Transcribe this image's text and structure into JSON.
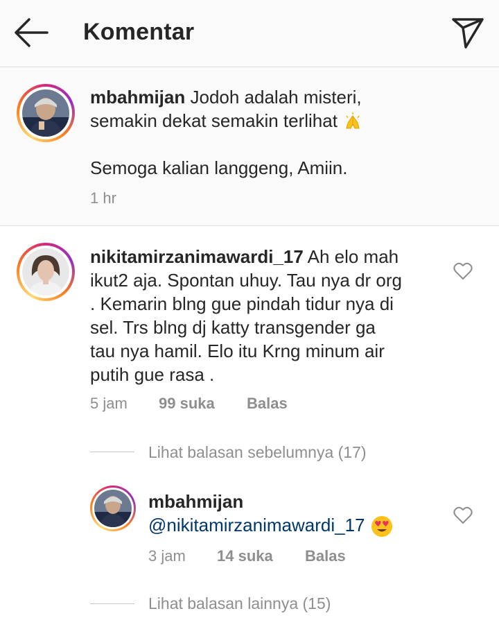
{
  "header": {
    "title": "Komentar",
    "back_icon": "arrow-left-icon",
    "share_icon": "paper-plane-icon"
  },
  "caption": {
    "username": "mbahmijan",
    "line1": "Jodoh adalah misteri,",
    "line2": "semakin dekat semakin terlihat",
    "line3": "Semoga kalian langgeng, Amiin.",
    "time": "1 hr",
    "emoji": "folded-hands-emoji"
  },
  "comments": [
    {
      "username": "nikitamirzanimawardi_17",
      "lines": [
        "Ah elo mah",
        "ikut2 aja. Spontan uhuy. Tau nya dr org",
        ". Kemarin blng gue pindah tidur nya di",
        "sel. Trs blng dj katty transgender ga",
        "tau nya hamil. Elo itu Krng minum air",
        "putih gue rasa ."
      ],
      "time": "5 jam",
      "likes": "99 suka",
      "reply_label": "Balas",
      "view_previous": "Lihat balasan sebelumnya (17)",
      "reply": {
        "username": "mbahmijan",
        "mention": "@nikitamirzanimawardi_17",
        "emoji": "heart-eyes-emoji",
        "time": "3 jam",
        "likes": "14 suka",
        "reply_label": "Balas"
      },
      "view_more": "Lihat balasan lainnya (15)"
    }
  ],
  "colors": {
    "text": "#262626",
    "secondary": "#8e8e8e",
    "mention": "#00376b",
    "header_bg": "#fafafa",
    "divider": "#dbdbdb"
  }
}
